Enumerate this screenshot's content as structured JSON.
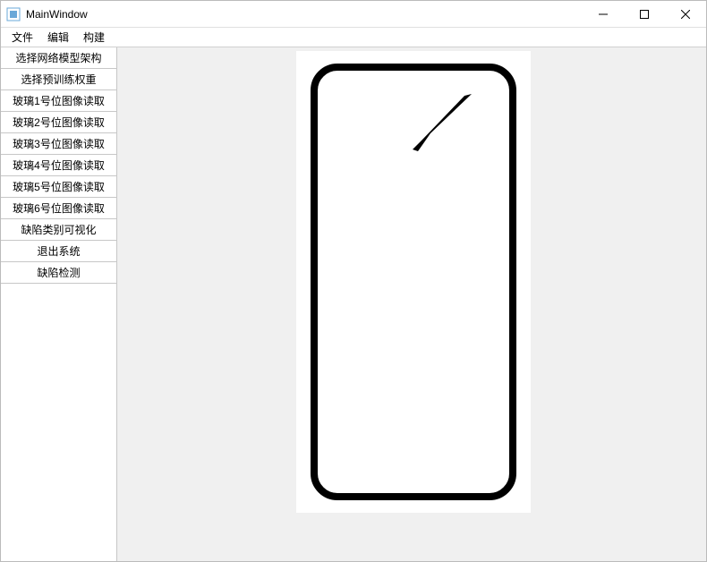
{
  "window": {
    "title": "MainWindow"
  },
  "menubar": [
    {
      "label": "文件"
    },
    {
      "label": "编辑"
    },
    {
      "label": "构建"
    }
  ],
  "sidebar": {
    "items": [
      {
        "label": "选择网络模型架构"
      },
      {
        "label": "选择预训练权重"
      },
      {
        "label": "玻璃1号位图像读取"
      },
      {
        "label": "玻璃2号位图像读取"
      },
      {
        "label": "玻璃3号位图像读取"
      },
      {
        "label": "玻璃4号位图像读取"
      },
      {
        "label": "玻璃5号位图像读取"
      },
      {
        "label": "玻璃6号位图像读取"
      },
      {
        "label": "缺陷类别可视化"
      },
      {
        "label": "退出系统"
      },
      {
        "label": "缺陷检测"
      }
    ]
  },
  "colors": {
    "canvas_bg": "#f0f0f0",
    "panel_bg": "#ffffff"
  }
}
